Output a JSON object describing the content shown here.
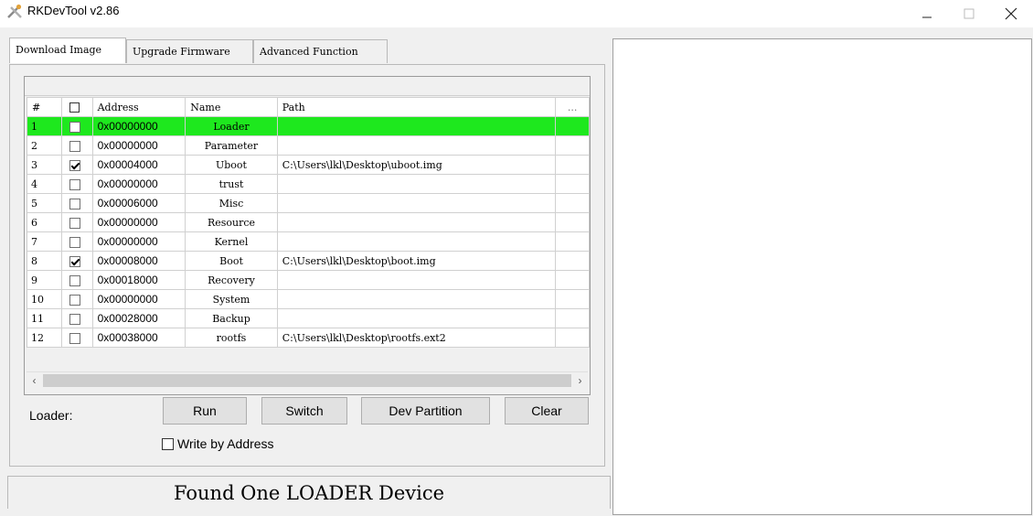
{
  "window": {
    "title": "RKDevTool v2.86",
    "icon": "rockchip-tools-icon",
    "controls": [
      "minimize-icon",
      "maximize-icon",
      "close-icon"
    ]
  },
  "tabs": [
    {
      "label": "Download Image",
      "active": true
    },
    {
      "label": "Upgrade Firmware",
      "active": false
    },
    {
      "label": "Advanced Function",
      "active": false
    }
  ],
  "table": {
    "headers": {
      "num": "#",
      "address": "Address",
      "name": "Name",
      "path": "Path",
      "more": "..."
    },
    "highlight_color": "#1ee81e",
    "rows": [
      {
        "num": "1",
        "checked": false,
        "address": "0x00000000",
        "name": "Loader",
        "path": "",
        "highlight": true
      },
      {
        "num": "2",
        "checked": false,
        "address": "0x00000000",
        "name": "Parameter",
        "path": ""
      },
      {
        "num": "3",
        "checked": true,
        "address": "0x00004000",
        "name": "Uboot",
        "path": "C:\\Users\\lkl\\Desktop\\uboot.img"
      },
      {
        "num": "4",
        "checked": false,
        "address": "0x00000000",
        "name": "trust",
        "path": ""
      },
      {
        "num": "5",
        "checked": false,
        "address": "0x00006000",
        "name": "Misc",
        "path": ""
      },
      {
        "num": "6",
        "checked": false,
        "address": "0x00000000",
        "name": "Resource",
        "path": ""
      },
      {
        "num": "7",
        "checked": false,
        "address": "0x00000000",
        "name": "Kernel",
        "path": ""
      },
      {
        "num": "8",
        "checked": true,
        "address": "0x00008000",
        "name": "Boot",
        "path": "C:\\Users\\lkl\\Desktop\\boot.img"
      },
      {
        "num": "9",
        "checked": false,
        "address": "0x00018000",
        "name": "Recovery",
        "path": ""
      },
      {
        "num": "10",
        "checked": false,
        "address": "0x00000000",
        "name": "System",
        "path": ""
      },
      {
        "num": "11",
        "checked": false,
        "address": "0x00028000",
        "name": "Backup",
        "path": ""
      },
      {
        "num": "12",
        "checked": false,
        "address": "0x00038000",
        "name": "rootfs",
        "path": "C:\\Users\\lkl\\Desktop\\rootfs.ext2"
      }
    ]
  },
  "controls": {
    "loader_label": "Loader:",
    "run": "Run",
    "switch": "Switch",
    "dev_partition": "Dev Partition",
    "clear": "Clear",
    "write_by_address": "Write by Address"
  },
  "status": "Found One LOADER Device"
}
